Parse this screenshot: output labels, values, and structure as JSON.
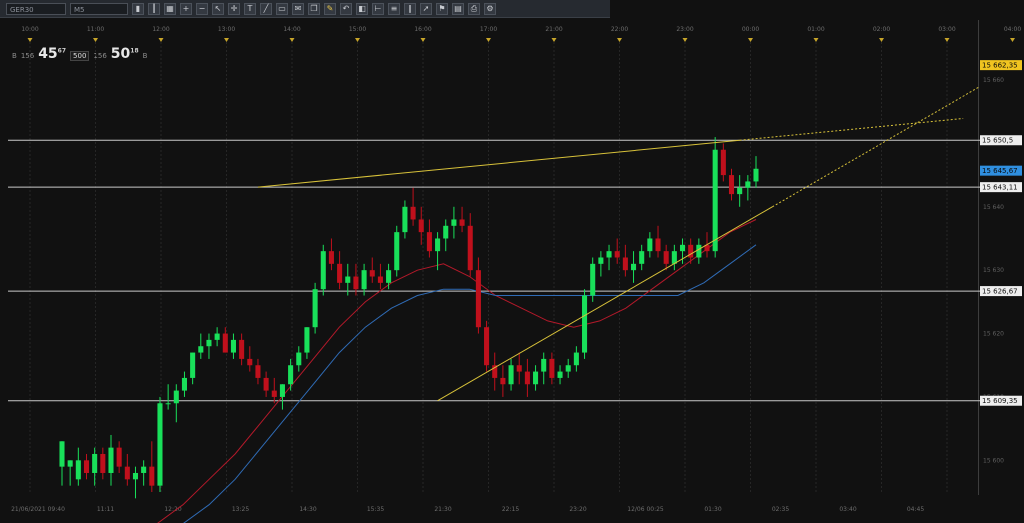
{
  "toolbar": {
    "symbol": "GER30",
    "timeframe": "M5",
    "icons": [
      "candles-icon",
      "bars-icon",
      "grid-icon",
      "zoom-in-icon",
      "zoom-out-icon",
      "cursor-icon",
      "crosshair-icon",
      "text-icon",
      "trendline-icon",
      "rectangle-icon",
      "comment-icon",
      "copy-icon",
      "pencil-icon",
      "undo-icon",
      "objects-icon",
      "ruler-icon",
      "fib-icon",
      "channel-icon",
      "arrow-icon",
      "flag-icon",
      "layout-icon",
      "print-icon",
      "settings-icon"
    ]
  },
  "quote": {
    "bid_prefix": "B",
    "bid_big_prefix": "156",
    "bid_big": "45",
    "bid_sup": "67",
    "lot": "500",
    "ask_big_prefix": "156",
    "ask_big": "50",
    "ask_sup": "18",
    "ask_suffix": "B"
  },
  "top_time_labels": [
    "10:00",
    "11:00",
    "12:00",
    "13:00",
    "14:00",
    "15:00",
    "16:00",
    "17:00",
    "21:00",
    "22:00",
    "23:00",
    "00:00",
    "01:00",
    "02:00",
    "03:00",
    "04:00"
  ],
  "bottom_time_labels": [
    "21/06/2021 09:40",
    "11:11",
    "12:20",
    "13:25",
    "14:30",
    "15:35",
    "21:30",
    "22:15",
    "23:20",
    "12/06 00:25",
    "01:30",
    "02:35",
    "03:40",
    "04:45"
  ],
  "chart_data": {
    "type": "candlestick",
    "symbol": "GER30",
    "timeframe": "M5",
    "y_range": [
      15595,
      15666
    ],
    "y_tick_labels": [
      "15 600",
      "15 610",
      "15 620",
      "15 630",
      "15 640",
      "15 660"
    ],
    "price_levels": [
      {
        "label": "15 650,5",
        "value": 15650.5
      },
      {
        "label": "15 643,11",
        "value": 15643.1
      },
      {
        "label": "15 626,67",
        "value": 15626.7
      },
      {
        "label": "15 609,35",
        "value": 15609.4
      }
    ],
    "last_price": {
      "label": "15 645,67",
      "value": 15645.7
    },
    "projected_price": {
      "label": "15 662,35",
      "value": 15662.35
    },
    "candles": [
      [
        15599,
        15603,
        15596,
        15603
      ],
      [
        15599,
        15600,
        15596,
        15600
      ],
      [
        15597,
        15602,
        15596,
        15600
      ],
      [
        15600,
        15601,
        15597,
        15598
      ],
      [
        15598,
        15602,
        15596,
        15601
      ],
      [
        15601,
        15602,
        15597,
        15598
      ],
      [
        15598,
        15604,
        15596,
        15602
      ],
      [
        15602,
        15603,
        15598,
        15599
      ],
      [
        15599,
        15601,
        15596,
        15597
      ],
      [
        15597,
        15599,
        15594,
        15598
      ],
      [
        15598,
        15600,
        15596,
        15599
      ],
      [
        15599,
        15603,
        15595,
        15596
      ],
      [
        15596,
        15610,
        15595,
        15609
      ],
      [
        15609,
        15612,
        15608,
        15609
      ],
      [
        15609,
        15612,
        15606,
        15611
      ],
      [
        15611,
        15614,
        15610,
        15613
      ],
      [
        15613,
        15617,
        15612,
        15617
      ],
      [
        15617,
        15620,
        15616,
        15618
      ],
      [
        15618,
        15620,
        15616,
        15619
      ],
      [
        15619,
        15621,
        15618,
        15620
      ],
      [
        15620,
        15621,
        15617,
        15617
      ],
      [
        15617,
        15620,
        15616,
        15619
      ],
      [
        15619,
        15620,
        15615,
        15616
      ],
      [
        15616,
        15618,
        15614,
        15615
      ],
      [
        15615,
        15616,
        15612,
        15613
      ],
      [
        15613,
        15614,
        15610,
        15611
      ],
      [
        15611,
        15613,
        15609,
        15610
      ],
      [
        15610,
        15612,
        15608,
        15612
      ],
      [
        15612,
        15616,
        15611,
        15615
      ],
      [
        15615,
        15618,
        15614,
        15617
      ],
      [
        15617,
        15621,
        15616,
        15621
      ],
      [
        15621,
        15628,
        15620,
        15627
      ],
      [
        15627,
        15634,
        15626,
        15633
      ],
      [
        15633,
        15635,
        15630,
        15631
      ],
      [
        15631,
        15633,
        15627,
        15628
      ],
      [
        15628,
        15631,
        15626,
        15629
      ],
      [
        15629,
        15631,
        15626,
        15627
      ],
      [
        15627,
        15631,
        15626,
        15630
      ],
      [
        15630,
        15632,
        15628,
        15629
      ],
      [
        15629,
        15631,
        15627,
        15628
      ],
      [
        15628,
        15631,
        15627,
        15630
      ],
      [
        15630,
        15637,
        15629,
        15636
      ],
      [
        15636,
        15641,
        15635,
        15640
      ],
      [
        15640,
        15643,
        15637,
        15638
      ],
      [
        15638,
        15640,
        15634,
        15636
      ],
      [
        15636,
        15638,
        15632,
        15633
      ],
      [
        15633,
        15636,
        15630,
        15635
      ],
      [
        15635,
        15638,
        15633,
        15637
      ],
      [
        15637,
        15640,
        15635,
        15638
      ],
      [
        15638,
        15640,
        15636,
        15637
      ],
      [
        15637,
        15639,
        15629,
        15630
      ],
      [
        15630,
        15632,
        15620,
        15621
      ],
      [
        15621,
        15622,
        15614,
        15615
      ],
      [
        15615,
        15617,
        15611,
        15613
      ],
      [
        15613,
        15615,
        15610,
        15612
      ],
      [
        15612,
        15616,
        15611,
        15615
      ],
      [
        15615,
        15617,
        15612,
        15614
      ],
      [
        15614,
        15616,
        15610,
        15612
      ],
      [
        15612,
        15615,
        15611,
        15614
      ],
      [
        15614,
        15617,
        15612,
        15616
      ],
      [
        15616,
        15617,
        15612,
        15613
      ],
      [
        15613,
        15615,
        15612,
        15614
      ],
      [
        15614,
        15616,
        15613,
        15615
      ],
      [
        15615,
        15618,
        15614,
        15617
      ],
      [
        15617,
        15627,
        15616,
        15626
      ],
      [
        15626,
        15632,
        15625,
        15631
      ],
      [
        15631,
        15633,
        15629,
        15632
      ],
      [
        15632,
        15634,
        15630,
        15633
      ],
      [
        15633,
        15635,
        15631,
        15632
      ],
      [
        15632,
        15634,
        15629,
        15630
      ],
      [
        15630,
        15633,
        15628,
        15631
      ],
      [
        15631,
        15634,
        15630,
        15633
      ],
      [
        15633,
        15636,
        15632,
        15635
      ],
      [
        15635,
        15637,
        15632,
        15633
      ],
      [
        15633,
        15634,
        15630,
        15631
      ],
      [
        15631,
        15634,
        15630,
        15633
      ],
      [
        15633,
        15635,
        15631,
        15634
      ],
      [
        15634,
        15635,
        15631,
        15632
      ],
      [
        15632,
        15635,
        15631,
        15634
      ],
      [
        15634,
        15636,
        15632,
        15633
      ],
      [
        15633,
        15651,
        15632,
        15649
      ],
      [
        15649,
        15650,
        15644,
        15645
      ],
      [
        15645,
        15646,
        15641,
        15642
      ],
      [
        15642,
        15645,
        15640,
        15643
      ],
      [
        15643,
        15645,
        15641,
        15644
      ],
      [
        15644,
        15648,
        15643,
        15646
      ]
    ],
    "indicators": [
      {
        "color": "#b3192a",
        "values": [
          15590,
          15593,
          15597,
          15601,
          15606,
          15611,
          15616,
          15621,
          15625,
          15628,
          15630,
          15631,
          15629,
          15626,
          15624,
          15622,
          15621,
          15622,
          15624,
          15627,
          15630,
          15633,
          15636,
          15638
        ]
      },
      {
        "color": "#2f6bb5",
        "values": [
          15588,
          15590,
          15593,
          15597,
          15602,
          15607,
          15612,
          15617,
          15621,
          15624,
          15626,
          15627,
          15627,
          15626,
          15626,
          15626,
          15626,
          15626,
          15626,
          15626,
          15626,
          15628,
          15631,
          15634
        ]
      }
    ],
    "trendlines": [
      {
        "from": [
          24,
          15643.1
        ],
        "to": [
          83,
          15650.5
        ],
        "extend_to": 92,
        "color": "#d8c23a"
      },
      {
        "from": [
          46,
          15609.4
        ],
        "to": [
          87,
          15640
        ],
        "extend_to": 94,
        "color": "#d8c23a"
      }
    ]
  }
}
